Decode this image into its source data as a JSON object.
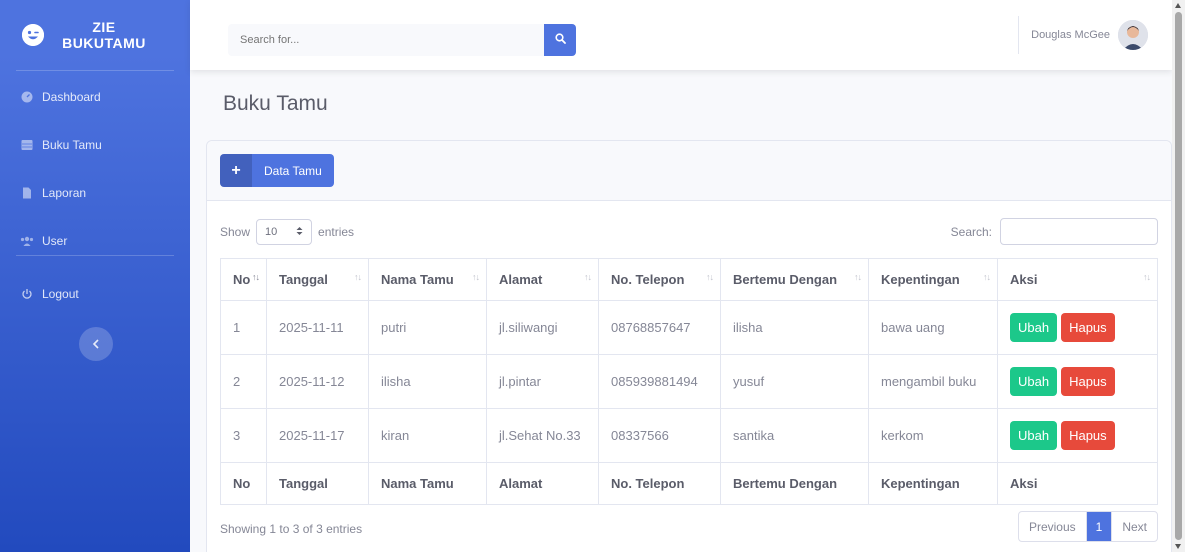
{
  "brand": {
    "line1": "ZIE",
    "line2": "BUKUTAMU"
  },
  "sidebar": {
    "items": [
      {
        "label": "Dashboard"
      },
      {
        "label": "Buku Tamu"
      },
      {
        "label": "Laporan"
      },
      {
        "label": "User"
      },
      {
        "label": "Logout"
      }
    ]
  },
  "topbar": {
    "search_placeholder": "Search for...",
    "user_name": "Douglas McGee"
  },
  "page": {
    "title": "Buku Tamu"
  },
  "card": {
    "add_button": "Data Tamu"
  },
  "datatable": {
    "show_label": "Show",
    "length_value": "10",
    "entries_label": "entries",
    "search_label": "Search:",
    "columns": [
      "No",
      "Tanggal",
      "Nama Tamu",
      "Alamat",
      "No. Telepon",
      "Bertemu Dengan",
      "Kepentingan",
      "Aksi"
    ],
    "rows": [
      [
        "1",
        "2025-11-11",
        "putri",
        "jl.siliwangi",
        "08768857647",
        "ilisha",
        "bawa uang"
      ],
      [
        "2",
        "2025-11-12",
        "ilisha",
        "jl.pintar",
        "085939881494",
        "yusuf",
        "mengambil buku"
      ],
      [
        "3",
        "2025-11-17",
        "kiran",
        "jl.Sehat No.33",
        "08337566",
        "santika",
        "kerkom"
      ]
    ],
    "edit_label": "Ubah",
    "delete_label": "Hapus",
    "info": "Showing 1 to 3 of 3 entries",
    "pagination": {
      "previous": "Previous",
      "current": "1",
      "next": "Next"
    }
  },
  "colors": {
    "primary": "#4e73df",
    "success": "#1cc88a",
    "danger": "#e74a3b"
  }
}
